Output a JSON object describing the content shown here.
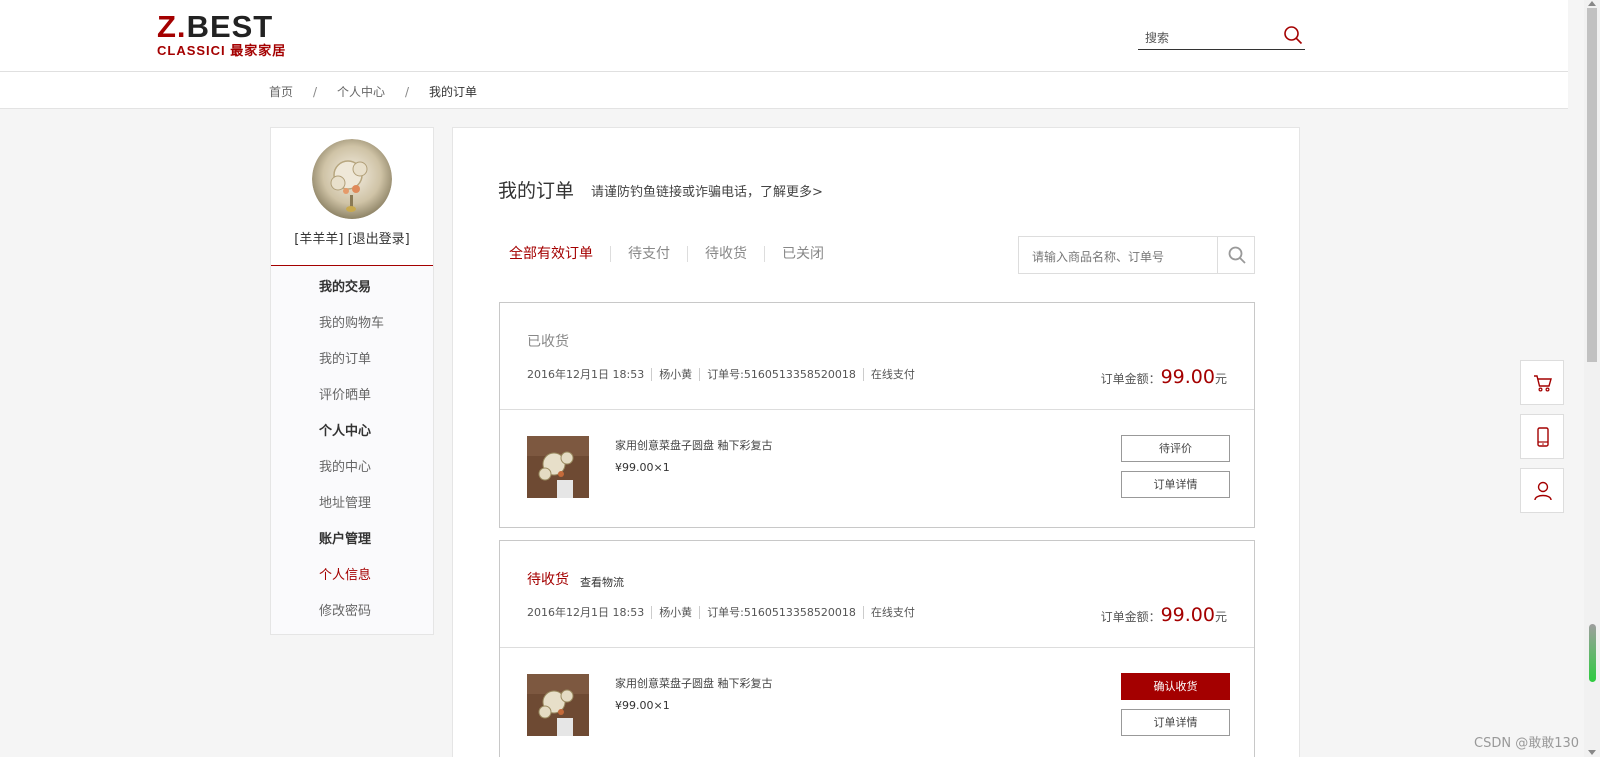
{
  "header": {
    "logo_line1_red": "Z.",
    "logo_line1": "BEST",
    "logo_line2": "CLASSICI 最家家居",
    "search_placeholder": "搜索"
  },
  "breadcrumb": {
    "items": [
      "首页",
      "个人中心",
      "我的订单"
    ],
    "separator": "/"
  },
  "sidebar": {
    "username": "[羊羊羊]",
    "logout": "[退出登录]",
    "items": [
      {
        "label": "我的交易",
        "type": "heading"
      },
      {
        "label": "我的购物车",
        "type": "link"
      },
      {
        "label": "我的订单",
        "type": "link"
      },
      {
        "label": "评价晒单",
        "type": "link"
      },
      {
        "label": "个人中心",
        "type": "heading"
      },
      {
        "label": "我的中心",
        "type": "link"
      },
      {
        "label": "地址管理",
        "type": "link"
      },
      {
        "label": "账户管理",
        "type": "heading"
      },
      {
        "label": "个人信息",
        "type": "active"
      },
      {
        "label": "修改密码",
        "type": "link"
      }
    ]
  },
  "main": {
    "title": "我的订单",
    "warning": "请谨防钓鱼链接或诈骗电话，了解更多>",
    "tabs": [
      "全部有效订单",
      "待支付",
      "待收货",
      "已关闭"
    ],
    "active_tab": "全部有效订单",
    "search_placeholder": "请输入商品名称、订单号"
  },
  "orders": [
    {
      "status": "已收货",
      "logistics_link": "",
      "date": "2016年12月1日 18:53",
      "recipient": "杨小黄",
      "order_no": "订单号:5160513358520018",
      "payment": "在线支付",
      "amount_label": "订单金额：",
      "amount": "99.00",
      "amount_unit": "元",
      "product_name": "家用创意菜盘子圆盘 釉下彩复古",
      "product_price": "¥99.00×1",
      "button1": "待评价",
      "button2": "订单详情"
    },
    {
      "status": "待收货",
      "logistics_link": "查看物流",
      "date": "2016年12月1日 18:53",
      "recipient": "杨小黄",
      "order_no": "订单号:5160513358520018",
      "payment": "在线支付",
      "amount_label": "订单金额：",
      "amount": "99.00",
      "amount_unit": "元",
      "product_name": "家用创意菜盘子圆盘 釉下彩复古",
      "product_price": "¥99.00×1",
      "button1": "确认收货",
      "button2": "订单详情"
    }
  ],
  "float_toolbar": [
    "cart-icon",
    "phone-icon",
    "user-icon"
  ],
  "watermark": "CSDN @敢敢130",
  "colors": {
    "accent": "#a40000",
    "background": "#f5f5f5"
  }
}
